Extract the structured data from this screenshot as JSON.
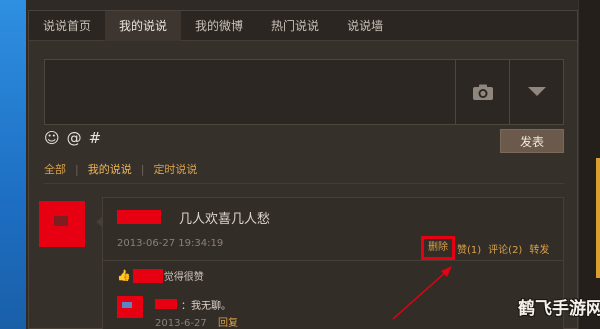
{
  "tabs": [
    {
      "label": "说说首页",
      "active": false
    },
    {
      "label": "我的说说",
      "active": true
    },
    {
      "label": "我的微博",
      "active": false
    },
    {
      "label": "热门说说",
      "active": false
    },
    {
      "label": "说说墙",
      "active": false
    }
  ],
  "composer": {
    "placeholder": "",
    "camera_icon": "camera-icon",
    "more_icon": "triangle-down-icon",
    "emoji_icons": [
      "☺",
      "@",
      "#"
    ],
    "post_label": "发表"
  },
  "filters": [
    {
      "label": "全部"
    },
    {
      "label": "我的说说"
    },
    {
      "label": "定时说说"
    }
  ],
  "post": {
    "text": "几人欢喜几人愁",
    "time": "2013-06-27 19:34:19",
    "actions": {
      "delete": "删除",
      "like": "赞(1)",
      "comment": "评论(2)",
      "forward": "转发"
    },
    "like_text": "觉得很赞",
    "comment": {
      "text": "：我无聊。",
      "date": "2013-6-27",
      "reply": "回复"
    }
  },
  "watermark": "鹤飞手游网",
  "colors": {
    "background": "#2f2a26",
    "accent": "#d9a04a",
    "redaction": "#e60012",
    "desktop_blue": "#2f8fe0"
  }
}
